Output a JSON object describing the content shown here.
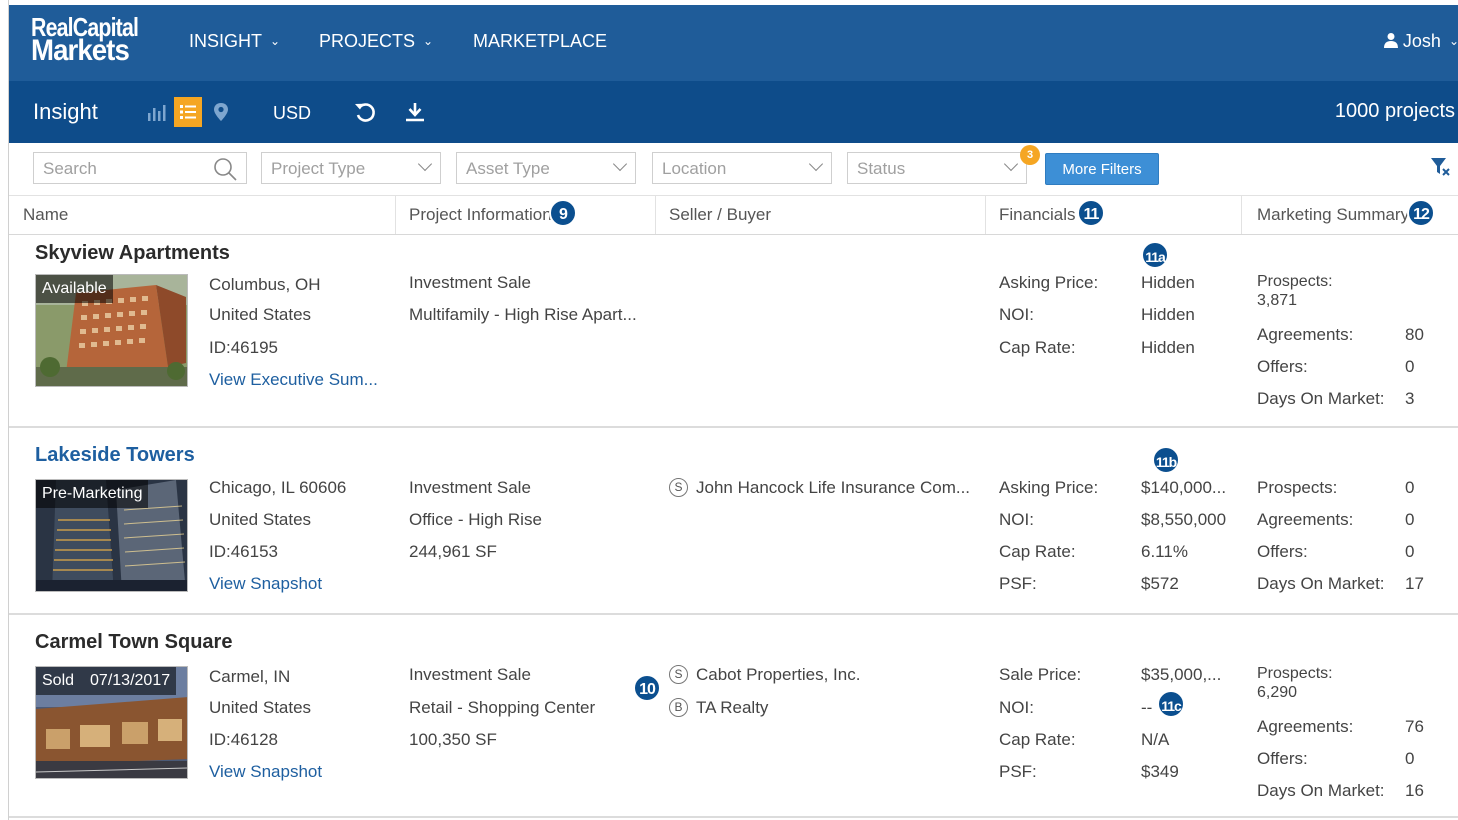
{
  "app": {
    "logo_line1": "RealCapital",
    "logo_line2": "Markets",
    "nav": [
      {
        "label": "INSIGHT"
      },
      {
        "label": "PROJECTS"
      },
      {
        "label": "MARKETPLACE"
      }
    ],
    "user": "Josh"
  },
  "toolbar": {
    "title": "Insight",
    "currency": "USD",
    "count": "1000 projects",
    "active_view": "list"
  },
  "filters": {
    "search_placeholder": "Search",
    "project_type": "Project Type",
    "asset_type": "Asset Type",
    "location": "Location",
    "status": "Status",
    "badge": "3",
    "more_filters": "More Filters"
  },
  "columns": {
    "name": "Name",
    "project_info": "Project Information",
    "seller_buyer": "Seller / Buyer",
    "financials": "Financials",
    "marketing": "Marketing Summary"
  },
  "callouts": {
    "c9": "9",
    "c10": "10",
    "c11": "11",
    "c11a": "11a",
    "c11b": "11b",
    "c11c": "11c",
    "c12": "12"
  },
  "projects": [
    {
      "name": "Skyview Apartments",
      "status": "Available",
      "city": "Columbus, OH",
      "country": "United States",
      "id": "ID:46195",
      "link": "View Executive Sum...",
      "sale_type": "Investment Sale",
      "property_type": "Multifamily - High Rise Apart...",
      "fin_labels": [
        "Asking Price:",
        "NOI:",
        "Cap Rate:"
      ],
      "fin_values": [
        "Hidden",
        "Hidden",
        "Hidden"
      ],
      "mkt": {
        "prospects_label": "Prospects:",
        "prospects": "3,871",
        "agreements_label": "Agreements:",
        "agreements": "80",
        "offers_label": "Offers:",
        "offers": "0",
        "dom_label": "Days On Market:",
        "dom": "3"
      }
    },
    {
      "name": "Lakeside Towers",
      "status": "Pre-Marketing",
      "city": "Chicago, IL 60606",
      "country": "United States",
      "id": "ID:46153",
      "link": "View Snapshot",
      "sale_type": "Investment Sale",
      "property_type": "Office - High Rise",
      "size": "244,961 SF",
      "seller_icon": "S",
      "seller": "John Hancock Life Insurance Com...",
      "fin_labels": [
        "Asking Price:",
        "NOI:",
        "Cap Rate:",
        "PSF:"
      ],
      "fin_values": [
        "$140,000...",
        "$8,550,000",
        "6.11%",
        "$572"
      ],
      "mkt": {
        "prospects_label": "Prospects:",
        "prospects": "0",
        "agreements_label": "Agreements:",
        "agreements": "0",
        "offers_label": "Offers:",
        "offers": "0",
        "dom_label": "Days On Market:",
        "dom": "17"
      }
    },
    {
      "name": "Carmel Town Square",
      "status": "Sold",
      "status_date": "07/13/2017",
      "city": "Carmel, IN",
      "country": "United States",
      "id": "ID:46128",
      "link": "View Snapshot",
      "sale_type": "Investment Sale",
      "property_type": "Retail - Shopping Center",
      "size": "100,350 SF",
      "seller_icon": "S",
      "seller": "Cabot Properties, Inc.",
      "buyer_icon": "B",
      "buyer": "TA Realty",
      "fin_labels": [
        "Sale Price:",
        "NOI:",
        "Cap Rate:",
        "PSF:"
      ],
      "fin_values": [
        "$35,000,...",
        "--",
        "N/A",
        "$349"
      ],
      "mkt": {
        "prospects_label": "Prospects:",
        "prospects": "6,290",
        "agreements_label": "Agreements:",
        "agreements": "76",
        "offers_label": "Offers:",
        "offers": "0",
        "dom_label": "Days On Market:",
        "dom": "16"
      }
    }
  ]
}
